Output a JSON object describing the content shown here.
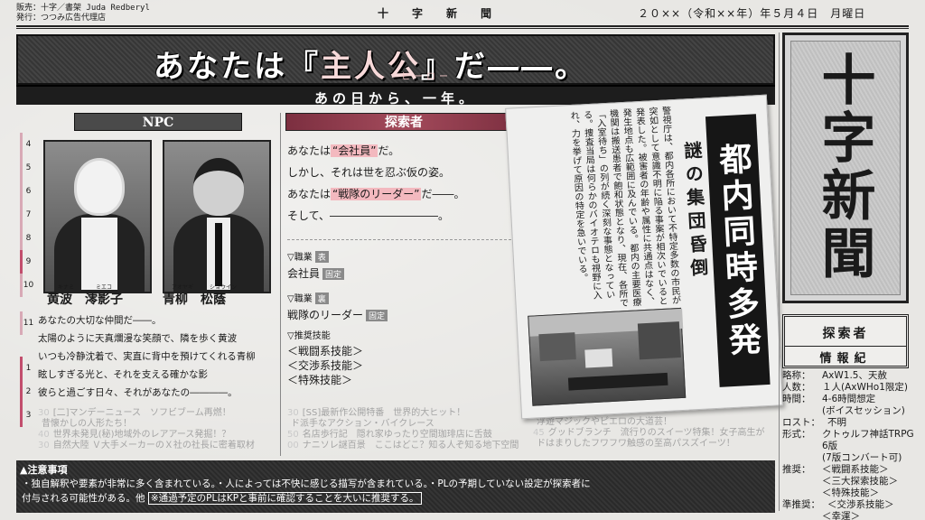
{
  "header": {
    "publisher_line1": "販売：十字／書架 Juda Redberyl",
    "publisher_line2": "発行：つつみ広告代理店",
    "newspaper_title": "十字新聞",
    "date": "２０××（令和××年）年５月４日　月曜日"
  },
  "banner": {
    "prefix": "あなたは『",
    "key": "主人公",
    "suffix": "』だ――。",
    "ruby": "ヒーロー",
    "subline": "あの日から、一年。"
  },
  "ruler": [
    "4",
    "5",
    "6",
    "7",
    "8",
    "9",
    "10",
    "11",
    "1",
    "2",
    "3"
  ],
  "npc": {
    "heading": "NPC",
    "characters": [
      {
        "ruby_family": "キナミ",
        "ruby_given": "ミエコ",
        "name": "黄波　澪影子"
      },
      {
        "ruby_family": "アオヤギ",
        "ruby_given": "ショウイン",
        "name": "青柳　松蔭"
      }
    ],
    "description": [
      "あなたの大切な仲間だ――。",
      "太陽のように天真爛漫な笑顔で、隣を歩く黄波",
      "いつも冷静沈着で、実直に背中を預けてくれる青柳",
      "眩しすぎる光と、それを支える確かな影",
      "彼らと過ごす日々、それがあなたの――――。"
    ]
  },
  "explorer": {
    "heading": "探索者",
    "line1_pre": "あなたは",
    "line1_hl": "“会社員”",
    "line1_post": "だ。",
    "line2": "しかし、それは世を忍ぶ仮の姿。",
    "line3_pre": "あなたは",
    "line3_hl": "“戦隊のリーダー”",
    "line3_post": "だ――。",
    "line4": "そして、――――――――――。",
    "job_front_label": "▽職業",
    "job_front_tag": "表",
    "job_front_value": "会社員",
    "job_front_fixed": "固定",
    "job_back_label": "▽職業",
    "job_back_tag": "裏",
    "job_back_value": "戦隊のリーダー",
    "job_back_fixed": "固定",
    "skills_label": "▽推奨技能",
    "skills": [
      "＜戦闘系技能＞",
      "＜交渉系技能＞",
      "＜特殊技能＞"
    ]
  },
  "faded_left": {
    "lines": [
      {
        "num": "30",
        "text": "[二]マンデーニュース　ソフビブーム再燃！"
      },
      {
        "num": "",
        "text": "昔懐かしの人形たち！"
      },
      {
        "num": "40",
        "text": "世界未発見(秘)地域外のレアアース発掘！？"
      },
      {
        "num": "30",
        "text": "自然大陸 Ｖ大手メーカーのＸ社の社長に密着取材"
      }
    ]
  },
  "faded_mid": {
    "lines": [
      {
        "num": "30",
        "text": "[SS]最新作公開特番　世界的大ヒット！"
      },
      {
        "num": "",
        "text": "ド派手なアクション・バイクレース"
      },
      {
        "num": "50",
        "text": "名店歩行記　隠れ家ゆったり空間珈琲店に舌鼓"
      },
      {
        "num": "00",
        "text": "ナニソレ謎百景　ここはどこ？知る人ぞ知る地下空間"
      }
    ]
  },
  "faded_right": {
    "lines": [
      {
        "num": "",
        "text": "浮遊マジックやピエロの大道芸！"
      },
      {
        "num": "45",
        "text": "グッドブランチ　流行りのスイーツ特集！女子高生が"
      },
      {
        "num": "",
        "text": "ドはまりしたフワフワ触感の至高パスズイーツ！"
      }
    ]
  },
  "article": {
    "headline": "都内同時多発",
    "subhead": "謎の集団昏倒",
    "body": "警視庁は、都内各所において不特定多数の市民が突如として意識不明に陥る事案が相次いでいると発表した。被害者の年齢や属性に共通点はなく、発生地点も広範囲に及んでいる。都内の主要医療機関は搬送患者で飽和状態となり、現在、各所で「入室待ち」の列が続く深刻な事態となっている。捜査当局は何らかのバイオテロも視野に入れ、力を挙げて原因の特定を急いでいる。"
  },
  "paper_name": "十字新聞",
  "info_box": {
    "line1": "探索者",
    "line2": "情報紀"
  },
  "info_list": [
    {
      "k": "略称：",
      "v": "AxW1.5、天赦"
    },
    {
      "k": "人数：",
      "v": "１人(AxWHo1限定)"
    },
    {
      "k": "時間：",
      "v": "4-6時間想定"
    },
    {
      "k": "",
      "v": "(ボイスセッション)"
    },
    {
      "k": "ロスト：",
      "v": "不明"
    },
    {
      "k": "形式：",
      "v": "クトゥルフ神話TRPG 6版"
    },
    {
      "k": "",
      "v": "(7版コンバート可)"
    },
    {
      "k": "推奨：",
      "v": "＜戦闘系技能＞"
    },
    {
      "k": "",
      "v": "＜三大探索技能＞"
    },
    {
      "k": "",
      "v": "＜特殊技能＞"
    },
    {
      "k": "準推奨：",
      "v": "＜交渉系技能＞"
    },
    {
      "k": "",
      "v": "＜幸運＞"
    }
  ],
  "notice": {
    "title": "▲注意事項",
    "line1": "・独自解釈や要素が非常に多く含まれている。・人によっては不快に感じる描写が含まれている。・PLの予期していない設定が探索者に",
    "line2_pre": "付与される可能性がある。他",
    "line2_boxed": "※通過予定のPLはKPと事前に確認することを大いに推奨する。"
  }
}
